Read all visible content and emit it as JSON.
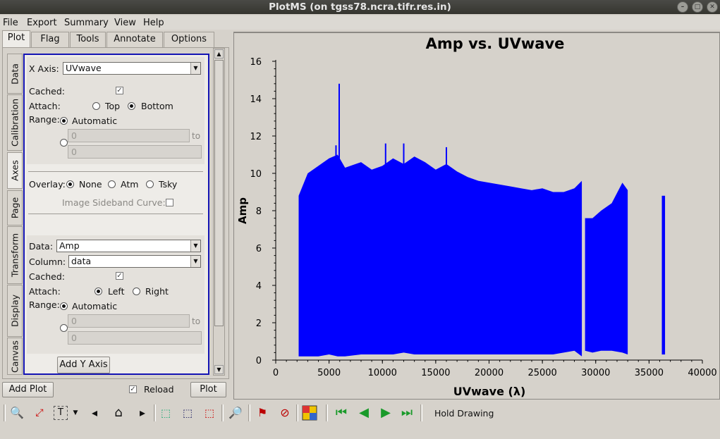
{
  "window": {
    "title": "PlotMS (on tgss78.ncra.tifr.res.in)"
  },
  "menu": [
    "File",
    "Export",
    "Summary",
    "View",
    "Help"
  ],
  "tabs": [
    "Plot",
    "Flag",
    "Tools",
    "Annotate",
    "Options"
  ],
  "side_tabs": [
    "Data",
    "Calibration",
    "Axes",
    "Page",
    "Transform",
    "Display",
    "Canvas"
  ],
  "axes": {
    "x_axis_label": "X Axis:",
    "x_axis_value": "UVwave",
    "cached_label": "Cached:",
    "attach_label": "Attach:",
    "attach_top": "Top",
    "attach_bottom": "Bottom",
    "range_label": "Range:",
    "automatic": "Automatic",
    "range_min": "0",
    "range_to": "to",
    "range_max": "0",
    "overlay_label": "Overlay:",
    "overlay_none": "None",
    "overlay_atm": "Atm",
    "overlay_tsky": "Tsky",
    "sideband_label": "Image Sideband Curve:",
    "y_data_label": "Data:",
    "y_data_value": "Amp",
    "column_label": "Column:",
    "column_value": "data",
    "y_cached_label": "Cached:",
    "y_attach_label": "Attach:",
    "attach_left": "Left",
    "attach_right": "Right",
    "y_range_label": "Range:",
    "y_automatic": "Automatic",
    "y_range_min": "0",
    "y_range_to": "to",
    "y_range_max": "0",
    "add_y_axis": "Add Y Axis"
  },
  "bottom": {
    "add_plot": "Add Plot",
    "reload": "Reload",
    "plot": "Plot"
  },
  "status": {
    "hold_drawing": "Hold Drawing"
  },
  "colors": {
    "accent": "#1414b4",
    "data": "#0000ff"
  },
  "chart_data": {
    "type": "scatter",
    "title": "Amp vs. UVwave",
    "xlabel": "UVwave (λ)",
    "ylabel": "Amp",
    "xlim": [
      0,
      40000
    ],
    "ylim": [
      0,
      16
    ],
    "xticks": [
      "0",
      "5000",
      "10000",
      "15000",
      "20000",
      "25000",
      "30000",
      "35000",
      "40000"
    ],
    "yticks": [
      "0",
      "2",
      "4",
      "6",
      "8",
      "10",
      "12",
      "14",
      "16"
    ],
    "grid": false,
    "legend": "none",
    "envelope": {
      "x": [
        2150,
        3000,
        4000,
        5000,
        5800,
        6500,
        8000,
        9000,
        10000,
        11000,
        12000,
        13000,
        14000,
        15000,
        16000,
        17000,
        18000,
        19000,
        20000,
        21000,
        22000,
        23000,
        24000,
        25000,
        26000,
        27000,
        28000,
        28700,
        29000,
        29700,
        30500,
        31500,
        32500,
        33000
      ],
      "y_max": [
        8.8,
        10.0,
        10.4,
        10.8,
        11.0,
        10.3,
        10.6,
        10.2,
        10.4,
        10.8,
        10.5,
        10.9,
        10.6,
        10.2,
        10.5,
        10.1,
        9.8,
        9.6,
        9.5,
        9.4,
        9.3,
        9.2,
        9.1,
        9.2,
        9.0,
        9.0,
        9.2,
        9.6,
        7.6,
        7.6,
        8.0,
        8.4,
        9.5,
        9.1
      ],
      "y_min": [
        0.2,
        0.2,
        0.2,
        0.3,
        0.2,
        0.2,
        0.3,
        0.3,
        0.3,
        0.3,
        0.4,
        0.3,
        0.3,
        0.3,
        0.3,
        0.3,
        0.3,
        0.3,
        0.3,
        0.3,
        0.3,
        0.3,
        0.3,
        0.3,
        0.3,
        0.4,
        0.5,
        0.2,
        0.5,
        0.4,
        0.5,
        0.5,
        0.4,
        0.3
      ]
    },
    "gaps": [
      [
        28700,
        29000
      ]
    ],
    "isolated_band": {
      "x": [
        36200,
        36500
      ],
      "y": [
        0.3,
        8.8
      ]
    },
    "spikes": [
      {
        "x": 5950,
        "y": 14.8
      },
      {
        "x": 5650,
        "y": 11.5
      },
      {
        "x": 10300,
        "y": 11.6
      },
      {
        "x": 12000,
        "y": 11.6
      },
      {
        "x": 16000,
        "y": 11.4
      }
    ]
  }
}
